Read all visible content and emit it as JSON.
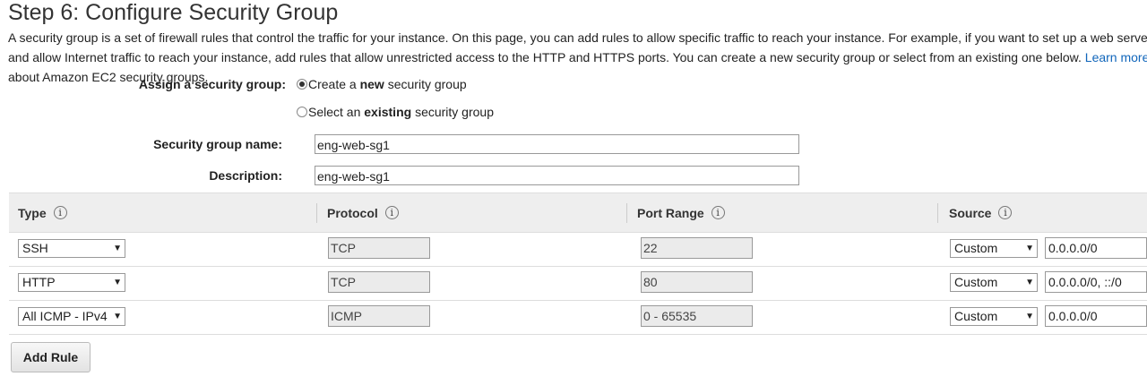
{
  "page": {
    "title": "Step 6: Configure Security Group",
    "description_before_link": "A security group is a set of firewall rules that control the traffic for your instance. On this page, you can add rules to allow specific traffic to reach your instance. For example, if you want to set up a web server and allow Internet traffic to reach your instance, add rules that allow unrestricted access to the HTTP and HTTPS ports. You can create a new security group or select from an existing one below.",
    "learn_more": "Learn more",
    "description_after_link": "about Amazon EC2 security groups."
  },
  "form": {
    "assign_label": "Assign a security group:",
    "radio_create": {
      "pre": "Create a ",
      "bold": "new",
      "post": " security group",
      "checked": true
    },
    "radio_select": {
      "pre": "Select an ",
      "bold": "existing",
      "post": " security group",
      "checked": false
    },
    "name_label": "Security group name:",
    "name_value": "eng-web-sg1",
    "description_label": "Description:",
    "description_value": "eng-web-sg1"
  },
  "table": {
    "headers": {
      "type": "Type",
      "protocol": "Protocol",
      "port_range": "Port Range",
      "source": "Source"
    },
    "info_glyph": "i",
    "rows": [
      {
        "type": "SSH",
        "protocol": "TCP",
        "port_range": "22",
        "source_type": "Custom",
        "source": "0.0.0.0/0"
      },
      {
        "type": "HTTP",
        "protocol": "TCP",
        "port_range": "80",
        "source_type": "Custom",
        "source": "0.0.0.0/0, ::/0"
      },
      {
        "type": "All ICMP - IPv4",
        "protocol": "ICMP",
        "port_range": "0 - 65535",
        "source_type": "Custom",
        "source": "0.0.0.0/0"
      }
    ]
  },
  "actions": {
    "add_rule": "Add Rule"
  },
  "colors": {
    "link": "#1166bb",
    "header_bg": "#eeeeee",
    "readonly_bg": "#ebebeb"
  },
  "icons": {
    "info": "info-icon",
    "dropdown": "chevron-down-icon",
    "radio": "radio-icon"
  }
}
